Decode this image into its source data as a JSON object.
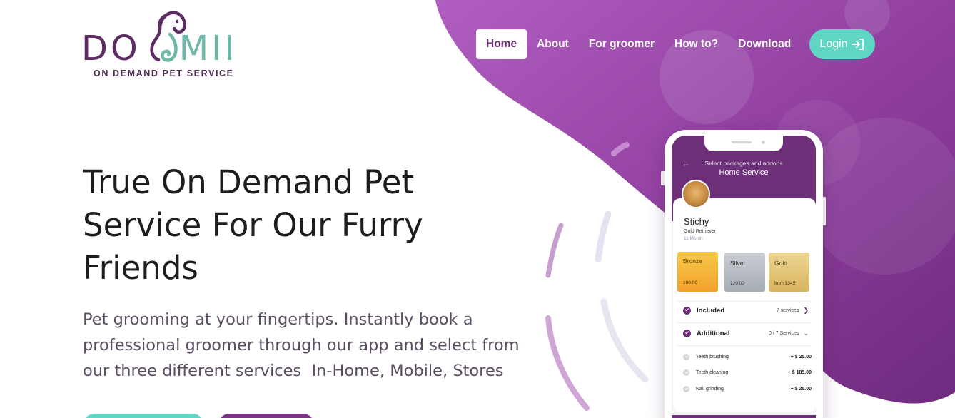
{
  "logo": {
    "wordmark_left": "DO",
    "wordmark_right": "MII",
    "tagline": "ON DEMAND PET SERVICE"
  },
  "nav": {
    "items": [
      {
        "label": "Home",
        "active": true
      },
      {
        "label": "About",
        "active": false
      },
      {
        "label": "For groomer",
        "active": false
      },
      {
        "label": "How to?",
        "active": false
      },
      {
        "label": "Download",
        "active": false
      }
    ],
    "login_label": "Login"
  },
  "hero": {
    "title_line1": "True On Demand Pet",
    "title_line2": "Service For Our Furry",
    "title_line3": "Friends",
    "subtitle_line1": "Pet grooming at your fingertips. Instantly book a",
    "subtitle_line2": "professional groomer through our app and select from",
    "subtitle_line3": "our three different services  In-Home, Mobile, Stores"
  },
  "phone": {
    "caption": "Select packages and addons",
    "heading": "Home Service",
    "pet": {
      "name": "Stichy",
      "breed": "Gold Retriever",
      "age": "11 Month"
    },
    "packages": [
      {
        "name": "Bronze",
        "price": "100.00"
      },
      {
        "name": "Silver",
        "price": "120.00"
      },
      {
        "name": "Gold",
        "price": "from $345"
      }
    ],
    "included": {
      "label": "Included",
      "count": "7 services"
    },
    "additional": {
      "label": "Additional",
      "count": "0 / 7 Services"
    },
    "services": [
      {
        "name": "Teeth brushing",
        "price": "+ $ 25.00"
      },
      {
        "name": "Teeth cleaning",
        "price": "+ $ 185.00"
      },
      {
        "name": "Nail grinding",
        "price": "+ $ 25.00"
      }
    ]
  },
  "colors": {
    "brand_purple": "#6c2f78",
    "accent_teal": "#5fd6c4",
    "blob_purple": "#9b45a8"
  }
}
